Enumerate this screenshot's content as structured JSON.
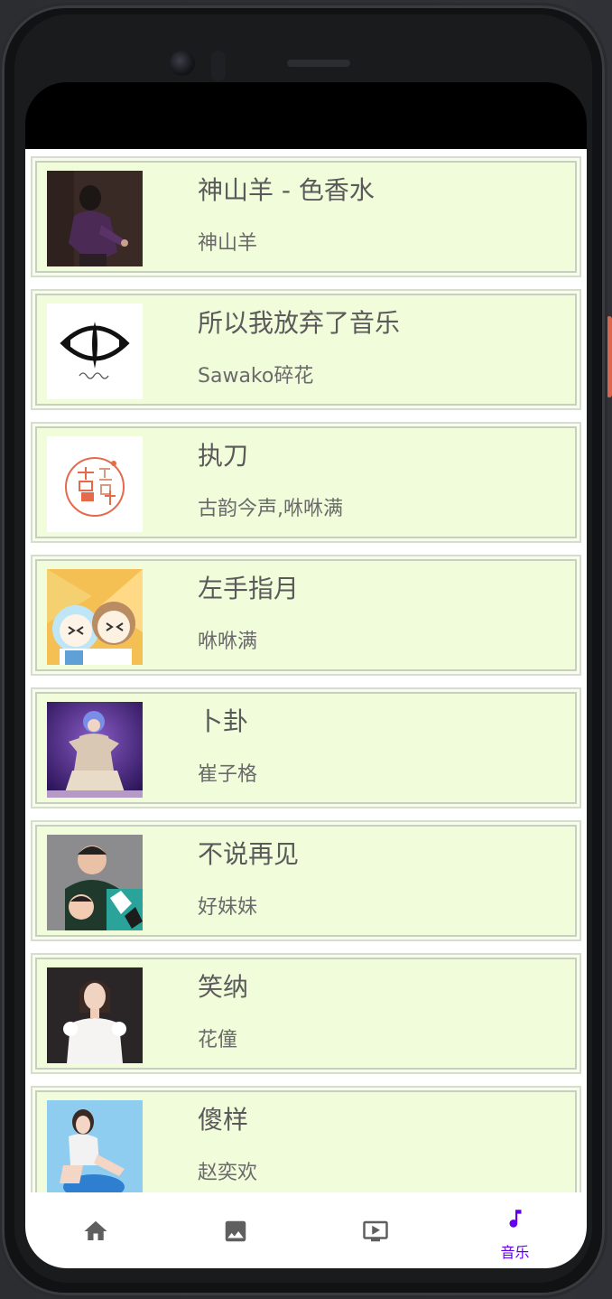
{
  "songs": [
    {
      "title": "神山羊 - 色香水",
      "artist": "神山羊",
      "cover": "portrait-dark"
    },
    {
      "title": "所以我放弃了音乐",
      "artist": "Sawako碎花",
      "cover": "logo-eye"
    },
    {
      "title": "执刀",
      "artist": "古韵今声,咻咻满",
      "cover": "logo-circle"
    },
    {
      "title": "左手指月",
      "artist": "咻咻满",
      "cover": "anime"
    },
    {
      "title": "卜卦",
      "artist": "崔子格",
      "cover": "stage-purple"
    },
    {
      "title": "不说再见",
      "artist": "好妹妹",
      "cover": "duo-photo"
    },
    {
      "title": "笑纳",
      "artist": "花僮",
      "cover": "portrait-white"
    },
    {
      "title": "傻样",
      "artist": "赵奕欢",
      "cover": "portrait-blue"
    }
  ],
  "nav": {
    "items": [
      {
        "icon": "home-icon",
        "label": ""
      },
      {
        "icon": "image-icon",
        "label": ""
      },
      {
        "icon": "video-icon",
        "label": ""
      },
      {
        "icon": "music-note-icon",
        "label": "音乐"
      }
    ],
    "active_color": "#6200ee",
    "inactive_color": "#5f5f5f"
  },
  "colors": {
    "card_bg": "#f0fcda",
    "title_text": "#5a5a5a"
  }
}
